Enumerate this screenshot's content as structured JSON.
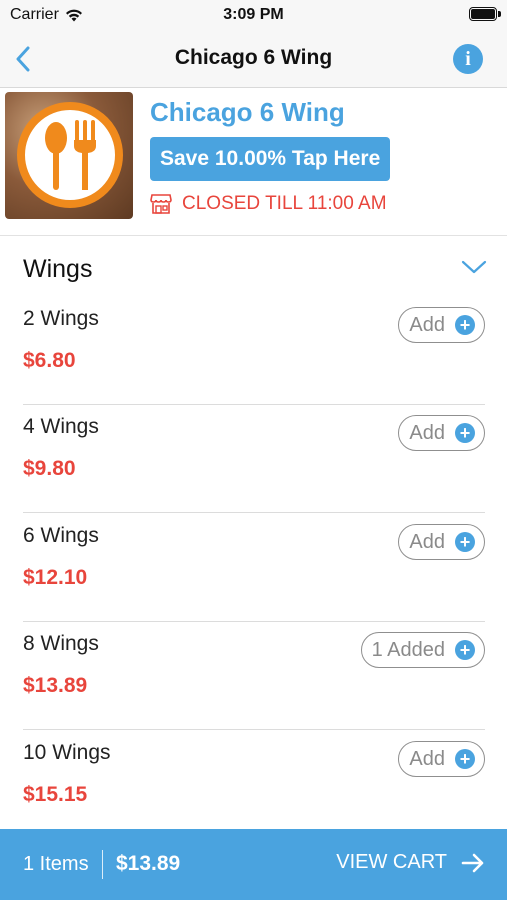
{
  "status_bar": {
    "carrier": "Carrier",
    "time": "3:09 PM"
  },
  "nav": {
    "title": "Chicago 6 Wing",
    "back_icon": "chevron-left-icon",
    "info_icon": "info-icon"
  },
  "restaurant": {
    "name": "Chicago 6 Wing",
    "save_label": "Save 10.00% Tap Here",
    "status": "CLOSED TILL 11:00 AM",
    "logo_icon": "spoon-fork-icon"
  },
  "category": {
    "title": "Wings",
    "expanded_icon": "chevron-down-icon"
  },
  "items": [
    {
      "name": "2 Wings",
      "price": "$6.80",
      "button": "Add"
    },
    {
      "name": "4 Wings",
      "price": "$9.80",
      "button": "Add"
    },
    {
      "name": "6 Wings",
      "price": "$12.10",
      "button": "Add"
    },
    {
      "name": "8 Wings",
      "price": "$13.89",
      "button": "1 Added"
    },
    {
      "name": "10 Wings",
      "price": "$15.15",
      "button": "Add"
    }
  ],
  "cart": {
    "count": "1 Items",
    "total": "$13.89",
    "view_label": "VIEW CART"
  },
  "colors": {
    "accent": "#4aa3df",
    "price": "#e8453c",
    "logo_orange": "#f08a1c"
  }
}
